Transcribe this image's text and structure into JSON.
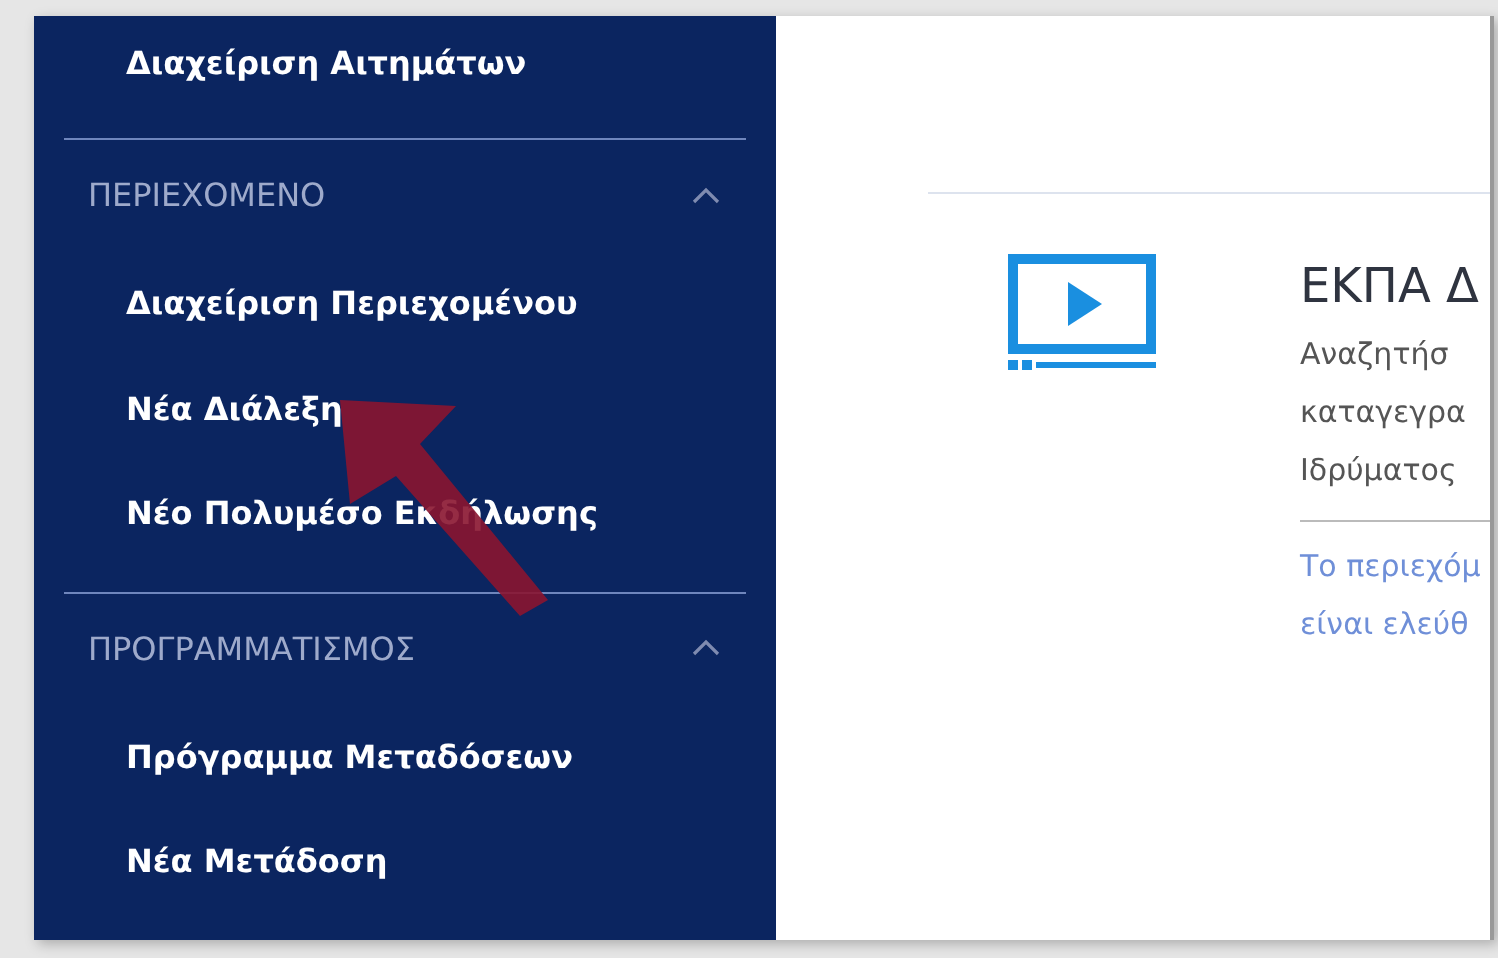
{
  "sidebar": {
    "groups": [
      {
        "items": [
          {
            "label": "Διαχείριση Αιτημάτων"
          }
        ]
      },
      {
        "title": "ΠΕΡΙΕΧΟΜΕΝΟ",
        "expanded": true,
        "items": [
          {
            "label": "Διαχείριση Περιεχομένου"
          },
          {
            "label": "Νέα Διάλεξη"
          },
          {
            "label": "Νέο Πολυμέσο Εκδήλωσης"
          }
        ]
      },
      {
        "title": "ΠΡΟΓΡΑΜΜΑΤΙΣΜΟΣ",
        "expanded": true,
        "items": [
          {
            "label": "Πρόγραμμα Μεταδόσεων"
          },
          {
            "label": "Νέα Μετάδοση"
          }
        ]
      }
    ]
  },
  "content": {
    "title": "ΕΚΠΑ Δ",
    "description_lines": [
      "Αναζητήσ",
      "καταγεγρα",
      "Ιδρύματος"
    ],
    "note_lines": [
      "Το περιεχόμ",
      "είναι ελεύθ"
    ]
  }
}
